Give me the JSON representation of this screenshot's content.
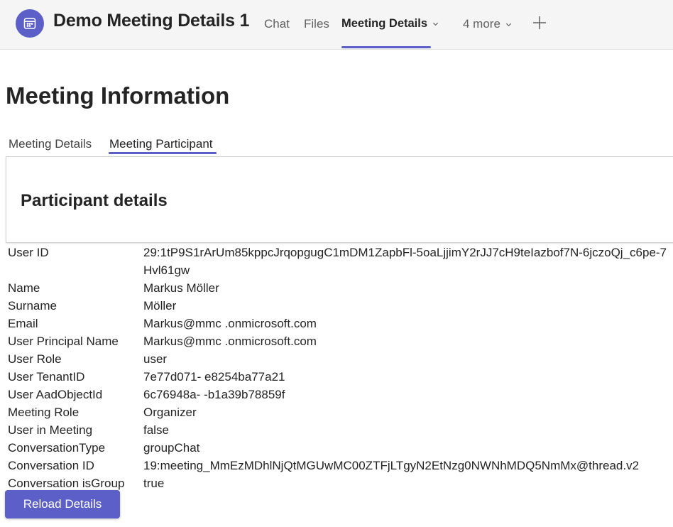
{
  "header": {
    "title": "Demo Meeting Details 1",
    "tabs": [
      {
        "label": "Chat",
        "active": false
      },
      {
        "label": "Files",
        "active": false
      },
      {
        "label": "Meeting Details",
        "active": true
      },
      {
        "label": "4 more",
        "active": false
      }
    ],
    "icons": {
      "app": "calendar-icon",
      "add": "plus-icon",
      "dropdown": "chevron-down-icon"
    },
    "accent_color": "#5b5fc7"
  },
  "page": {
    "heading": "Meeting Information",
    "subtabs": [
      {
        "label": "Meeting Details",
        "active": false
      },
      {
        "label": "Meeting Participant",
        "active": true
      }
    ],
    "card_title": "Participant details"
  },
  "details": [
    {
      "key": "User ID",
      "value": "29:1tP9S1rArUm85kppcJrqopgugC1mDM1ZapbFl-5oaLjjimY2rJJ7cH9teIazbof7N-6jczoQj_c6pe-7Hvl61gw"
    },
    {
      "key": "Name",
      "value": "Markus Möller"
    },
    {
      "key": "Surname",
      "value": "Möller"
    },
    {
      "key": "Email",
      "value": "Markus@mmc .onmicrosoft.com"
    },
    {
      "key": "User Principal Name",
      "value": "Markus@mmc .onmicrosoft.com"
    },
    {
      "key": "User Role",
      "value": "user"
    },
    {
      "key": "User TenantID",
      "value": "7e77d071- e8254ba77a21"
    },
    {
      "key": "User AadObjectId",
      "value": "6c76948a- -b1a39b78859f"
    },
    {
      "key": "Meeting Role",
      "value": "Organizer"
    },
    {
      "key": "User in Meeting",
      "value": "false"
    },
    {
      "key": "ConversationType",
      "value": "groupChat"
    },
    {
      "key": "Conversation ID",
      "value": "19:meeting_MmEzMDhlNjQtMGUwMC00ZTFjLTgyN2EtNzg0NWNhMDQ5NmMx@thread.v2"
    },
    {
      "key": "Conversation isGroup",
      "value": "true"
    }
  ],
  "actions": {
    "reload_label": "Reload Details"
  }
}
